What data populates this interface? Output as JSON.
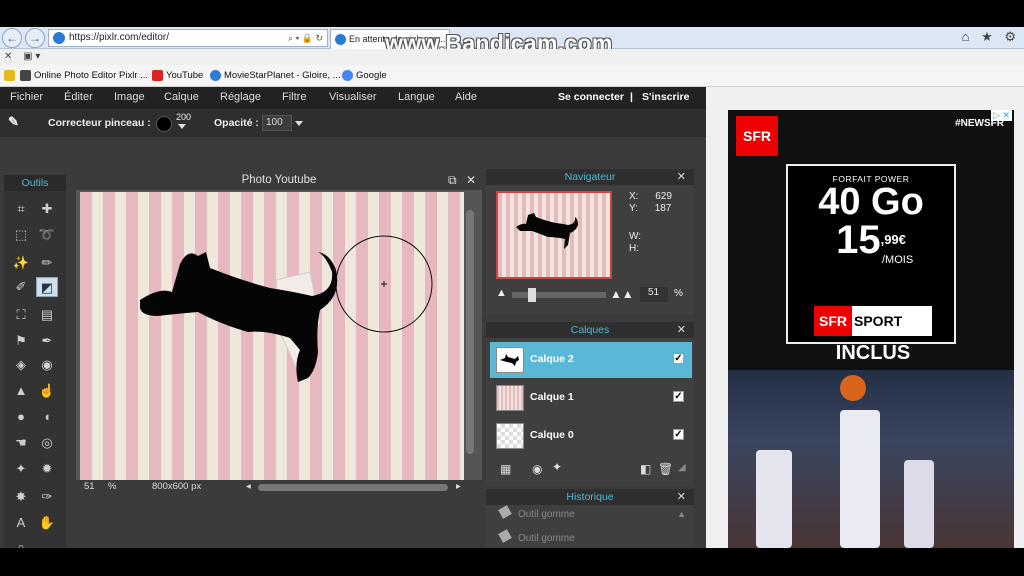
{
  "browser": {
    "url": "https://pixlr.com/editor/",
    "tab_title": "En attente de pixlr.com...",
    "watermark": "www.Bandicam.com",
    "favorites": [
      {
        "label": "Online Photo Editor Pixlr ...",
        "color": "#444444"
      },
      {
        "label": "YouTube",
        "color": "#dd2222"
      },
      {
        "label": "MovieStarPlanet - Gloire, ...",
        "color": "#2d7bd0"
      },
      {
        "label": "Google",
        "color": "#4285f4"
      }
    ]
  },
  "menu": {
    "items": [
      "Fichier",
      "Éditer",
      "Image",
      "Calque",
      "Réglage",
      "Filtre",
      "Visualiser",
      "Langue",
      "Aide"
    ],
    "login": "Se connecter",
    "separator": "|",
    "signup": "S'inscrire"
  },
  "options": {
    "brush_label": "Correcteur pinceau :",
    "brush_size": "200",
    "opacity_label": "Opacité :",
    "opacity_value": "100"
  },
  "tools": {
    "title": "Outils",
    "icons": [
      "crop-icon",
      "move-icon",
      "marquee-icon",
      "lasso-icon",
      "wand-icon",
      "pencil-icon",
      "brush-icon",
      "eraser-icon",
      "bucket-icon",
      "gradient-icon",
      "stamp-icon",
      "color-picker-icon",
      "drawing-icon",
      "drop-icon",
      "sharpen-icon",
      "smudge-icon",
      "sponge-icon",
      "burn-icon",
      "dodge-icon",
      "redeye-icon",
      "spot-heal-icon",
      "bloat-icon",
      "pinch-icon",
      "pen-icon",
      "text-icon",
      "hand-icon",
      "zoom-icon"
    ]
  },
  "document": {
    "title": "Photo Youtube",
    "zoom": "51",
    "zoom_unit": "%",
    "size": "800x600 px"
  },
  "navigator": {
    "title": "Navigateur",
    "x_label": "X:",
    "x_value": "629",
    "y_label": "Y:",
    "y_value": "187",
    "w_label": "W:",
    "h_label": "H:",
    "zoom": "51",
    "zoom_unit": "%"
  },
  "layers": {
    "title": "Calques",
    "items": [
      {
        "name": "Calque 2",
        "selected": true,
        "visible": true
      },
      {
        "name": "Calque 1",
        "selected": false,
        "visible": true
      },
      {
        "name": "Calque 0",
        "selected": false,
        "visible": true
      }
    ]
  },
  "history": {
    "title": "Historique",
    "items": [
      "Outil gomme",
      "Outil gomme",
      "Outil gomme"
    ]
  },
  "ad": {
    "brand": "SFR",
    "hashtag": "#NEWSFR",
    "forfait": "FORFAIT POWER",
    "data": "40 Go",
    "price_main": "15",
    "price_cents": ",99€",
    "price_period": "/MOIS",
    "sport_brand": "SFR",
    "sport_word": "SPORT",
    "inclus": "INCLUS"
  }
}
